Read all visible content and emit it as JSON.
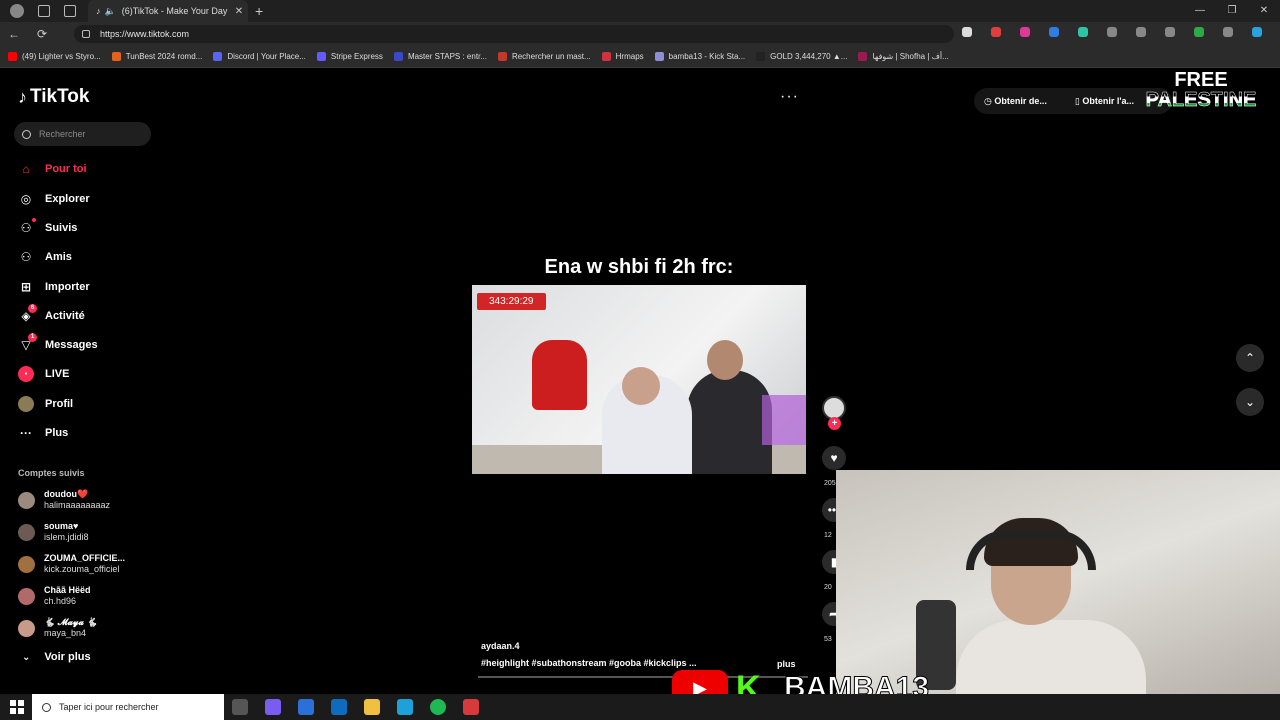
{
  "browser": {
    "tab_title": "(6)TikTok - Make Your Day",
    "url": "https://www.tiktok.com",
    "bookmarks": [
      {
        "label": "(49) Lighter vs Styro...",
        "color": "#ff0000"
      },
      {
        "label": "TunBest 2024 romd...",
        "color": "#e2631b"
      },
      {
        "label": "Discord | Your Place...",
        "color": "#5865f2"
      },
      {
        "label": "Stripe Express",
        "color": "#635bff"
      },
      {
        "label": "Master STAPS : entr...",
        "color": "#3a49c8"
      },
      {
        "label": "Rechercher un mast...",
        "color": "#c0392b"
      },
      {
        "label": "Hrmaps",
        "color": "#d1323f"
      },
      {
        "label": "bamba13 - Kick Sta...",
        "color": "#8e8ed6"
      },
      {
        "label": "GOLD 3,444,270 ▲...",
        "color": "#222222"
      },
      {
        "label": "شوفها | Shofha | أف...",
        "color": "#9b1b4e"
      }
    ],
    "window_controls": [
      "—",
      "❐",
      "✕"
    ]
  },
  "sidebar": {
    "logo": "TikTok",
    "search_placeholder": "Rechercher",
    "nav": [
      {
        "label": "Pour toi",
        "icon": "home-icon",
        "glyph": "⌂"
      },
      {
        "label": "Explorer",
        "icon": "compass-icon",
        "glyph": "◎"
      },
      {
        "label": "Suivis",
        "icon": "following-icon",
        "glyph": "⚇"
      },
      {
        "label": "Amis",
        "icon": "friends-icon",
        "glyph": "⚇"
      },
      {
        "label": "Importer",
        "icon": "upload-icon",
        "glyph": "⊞"
      },
      {
        "label": "Activité",
        "icon": "activity-icon",
        "glyph": "◈",
        "badge": "6"
      },
      {
        "label": "Messages",
        "icon": "messages-icon",
        "glyph": "▽",
        "badge": "1"
      },
      {
        "label": "LIVE",
        "icon": "live-icon",
        "glyph": "●"
      },
      {
        "label": "Profil",
        "icon": "profile-icon",
        "glyph": "●"
      },
      {
        "label": "Plus",
        "icon": "more-icon",
        "glyph": "···"
      }
    ],
    "followed_title": "Comptes suivis",
    "accounts": [
      {
        "name": "doudou❤️",
        "handle": "halimaaaaaaaaz"
      },
      {
        "name": "souma♥",
        "handle": "islem.jdidi8"
      },
      {
        "name": "ZOUMA_OFFICIE...",
        "handle": "kick.zouma_officiel"
      },
      {
        "name": "Chãã Hëëd",
        "handle": "ch.hd96"
      },
      {
        "name": "🐇 𝓜𝓪𝔂𝓪 🐇",
        "handle": "maya_bn4"
      }
    ],
    "see_more": "Voir plus"
  },
  "video": {
    "caption": "Ena w shbi fi 2h frc:",
    "timer": "343:29:29",
    "author": "aydaan.4",
    "tags": "#heighlight  #subathonstream  #gooba  #kickclips  ...",
    "more_label": "plus",
    "counts": [
      "205",
      "12",
      "20",
      "53"
    ]
  },
  "top": {
    "menu_dots": "···",
    "btn_app": "Obtenir de...",
    "btn_pc": "Obtenir l'a..."
  },
  "overlay": {
    "free": "FREE",
    "palestine": "PALESTINE",
    "streamer": "BAMBA13"
  },
  "taskbar": {
    "search_placeholder": "Taper ici pour rechercher"
  }
}
